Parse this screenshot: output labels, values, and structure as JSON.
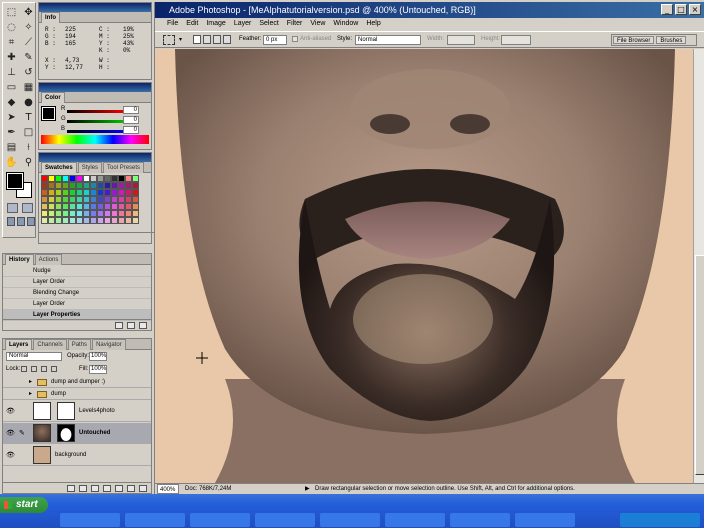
{
  "app": {
    "window_title": "Adobe Photoshop - [MeAlphatutorialversion.psd @ 400% (Untouched, RGB)]",
    "window_buttons": [
      "_",
      "□",
      "×"
    ]
  },
  "menu": [
    "File",
    "Edit",
    "Image",
    "Layer",
    "Select",
    "Filter",
    "View",
    "Window",
    "Help"
  ],
  "options_bar": {
    "feather_label": "Feather:",
    "feather_value": "0 px",
    "anti_aliased_label": "Anti-aliased",
    "style_label": "Style:",
    "style_value": "Normal",
    "width_label": "Width:",
    "height_label": "Height:",
    "palette_well_tabs": [
      "File Browser",
      "Brushes"
    ]
  },
  "info_panel": {
    "tab": "Info",
    "r_label": "R :",
    "r_value": "225",
    "g_label": "G :",
    "g_value": "194",
    "b_label": "B :",
    "b_value": "165",
    "c_label": "C :",
    "c_value": "19%",
    "m_label": "M :",
    "m_value": "25%",
    "y_label": "Y :",
    "y_value": "43%",
    "k_label": "K :",
    "k_value": "0%",
    "x_label": "X :",
    "x_value": "4,73",
    "y2_label": "Y :",
    "y2_value": "12,77",
    "w_label": "W :",
    "h_label": "H :"
  },
  "color_panel": {
    "tab": "Color",
    "r_label": "R",
    "r_value": "0",
    "g_label": "G",
    "g_value": "0",
    "b_label": "B",
    "b_value": "0"
  },
  "swatches_panel": {
    "tabs": [
      "Swatches",
      "Styles",
      "Tool Presets"
    ]
  },
  "history_panel": {
    "tabs": [
      "History",
      "Actions"
    ],
    "items": [
      "Nudge",
      "Layer Order",
      "Blending Change",
      "Layer Order",
      "Layer Properties"
    ]
  },
  "layers_panel": {
    "tabs": [
      "Layers",
      "Channels",
      "Paths",
      "Navigator"
    ],
    "blend_mode": "Normal",
    "opacity_label": "Opacity:",
    "opacity_value": "100%",
    "lock_label": "Lock:",
    "fill_label": "Fill:",
    "fill_value": "100%",
    "layers": [
      "dump and dumper :)",
      "dump",
      "Levels4photo",
      "Untouched",
      "background"
    ]
  },
  "status_bar": {
    "zoom": "400%",
    "doc_size": "Doc: 768K/7,24M",
    "message": "Draw rectangular selection or move selection outline.  Use Shift, Alt, and Ctrl for additional options."
  },
  "taskbar": {
    "start_label": "start"
  },
  "colors": {
    "title_active": "#0a246a",
    "canvas_bg": "#e8c8a8",
    "taskbar_blue": "#245edb",
    "start_green": "#2d8a36"
  }
}
